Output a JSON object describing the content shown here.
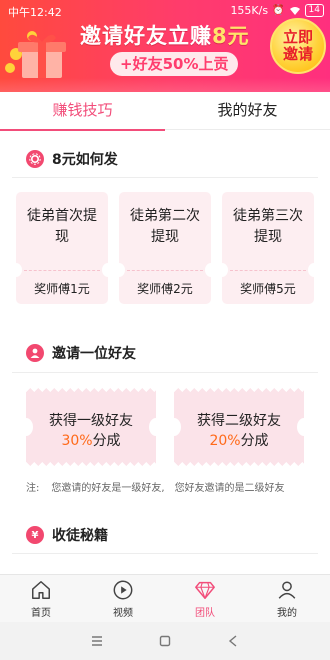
{
  "status_bar": {
    "time": "中午12:42",
    "speed": "155K/s",
    "battery": "14"
  },
  "banner": {
    "title_main": "邀请好友立赚",
    "title_amount": "8元",
    "subtitle": "+好友50%上贡",
    "invite_button": "立即邀请",
    "colors": {
      "start": "#ff4a3d",
      "end": "#ff2f7e",
      "accent": "#ffe36a"
    }
  },
  "tabs": [
    {
      "label": "赚钱技巧",
      "active": true
    },
    {
      "label": "我的好友",
      "active": false
    }
  ],
  "section_how": {
    "title": "8元如何发",
    "cards": [
      {
        "title": "徒弟首次提现",
        "reward": "奖师傅1元"
      },
      {
        "title": "徒弟第二次提现",
        "reward": "奖师傅2元"
      },
      {
        "title": "徒弟第三次提现",
        "reward": "奖师傅5元"
      }
    ]
  },
  "section_invite": {
    "title": "邀请一位好友",
    "tickets": [
      {
        "title": "获得一级好友",
        "percent": "30%",
        "suffix": "分成"
      },
      {
        "title": "获得二级好友",
        "percent": "20%",
        "suffix": "分成"
      }
    ],
    "note_label": "注:",
    "note_part1": "您邀请的好友是一级好友,",
    "note_part2": "您好友邀请的是二级好友"
  },
  "section_secret": {
    "title": "收徒秘籍"
  },
  "bottom_nav": [
    {
      "label": "首页",
      "icon": "home-icon",
      "active": false
    },
    {
      "label": "视频",
      "icon": "play-icon",
      "active": false
    },
    {
      "label": "团队",
      "icon": "diamond-icon",
      "active": true
    },
    {
      "label": "我的",
      "icon": "user-icon",
      "active": false
    }
  ],
  "accent_color": "#f24d7a"
}
